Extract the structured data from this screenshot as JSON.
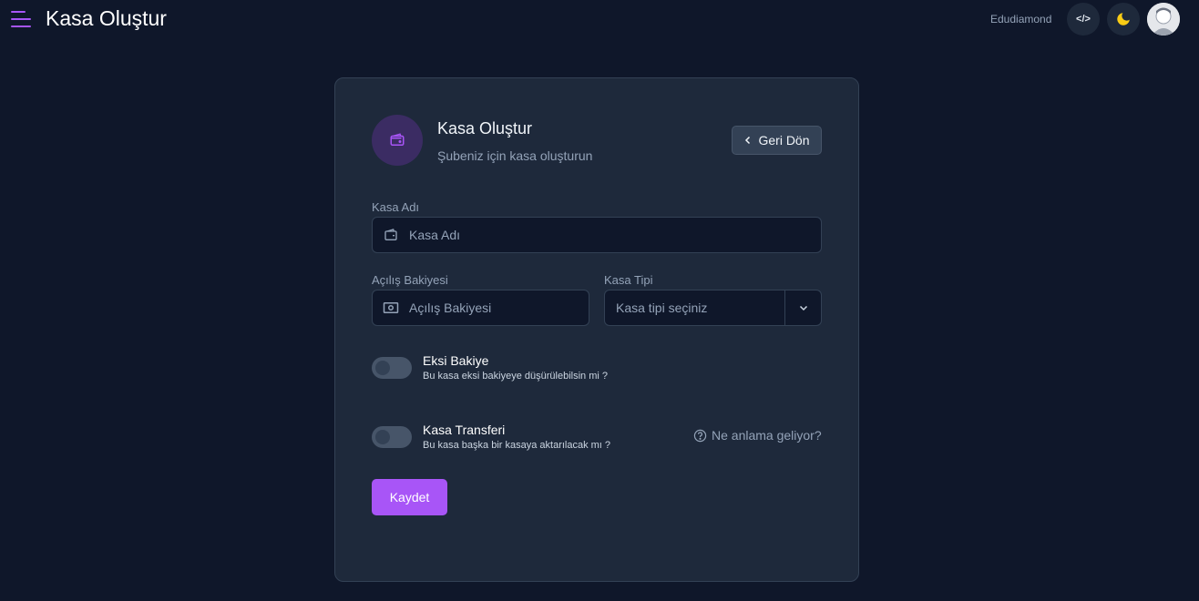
{
  "topbar": {
    "title": "Kasa Oluştur",
    "username": "Edudiamond",
    "code_icon_glyph": "</>"
  },
  "card": {
    "title": "Kasa Oluştur",
    "subtitle": "Şubeniz için kasa oluşturun",
    "back_label": "Geri Dön"
  },
  "form": {
    "name": {
      "label": "Kasa Adı",
      "placeholder": "Kasa Adı",
      "value": ""
    },
    "balance": {
      "label": "Açılış Bakiyesi",
      "placeholder": "Açılış Bakiyesi",
      "value": ""
    },
    "type": {
      "label": "Kasa Tipi",
      "selected": "Kasa tipi seçiniz"
    },
    "negative": {
      "title": "Eksi Bakiye",
      "description": "Bu kasa eksi bakiyeye düşürülebilsin mi ?",
      "enabled": false
    },
    "transfer": {
      "title": "Kasa Transferi",
      "description": "Bu kasa başka bir kasaya aktarılacak mı ?",
      "enabled": false
    },
    "help": "Ne anlama geliyor?",
    "save_label": "Kaydet"
  },
  "colors": {
    "accent": "#a855f7",
    "background": "#0f172a",
    "card": "#1e293b",
    "moon": "#facc15"
  },
  "icons": [
    "menu-icon",
    "code-icon",
    "moon-icon",
    "avatar",
    "wallet-icon",
    "chevron-left-icon",
    "money-icon",
    "chevron-down-icon",
    "help-circle-icon"
  ]
}
